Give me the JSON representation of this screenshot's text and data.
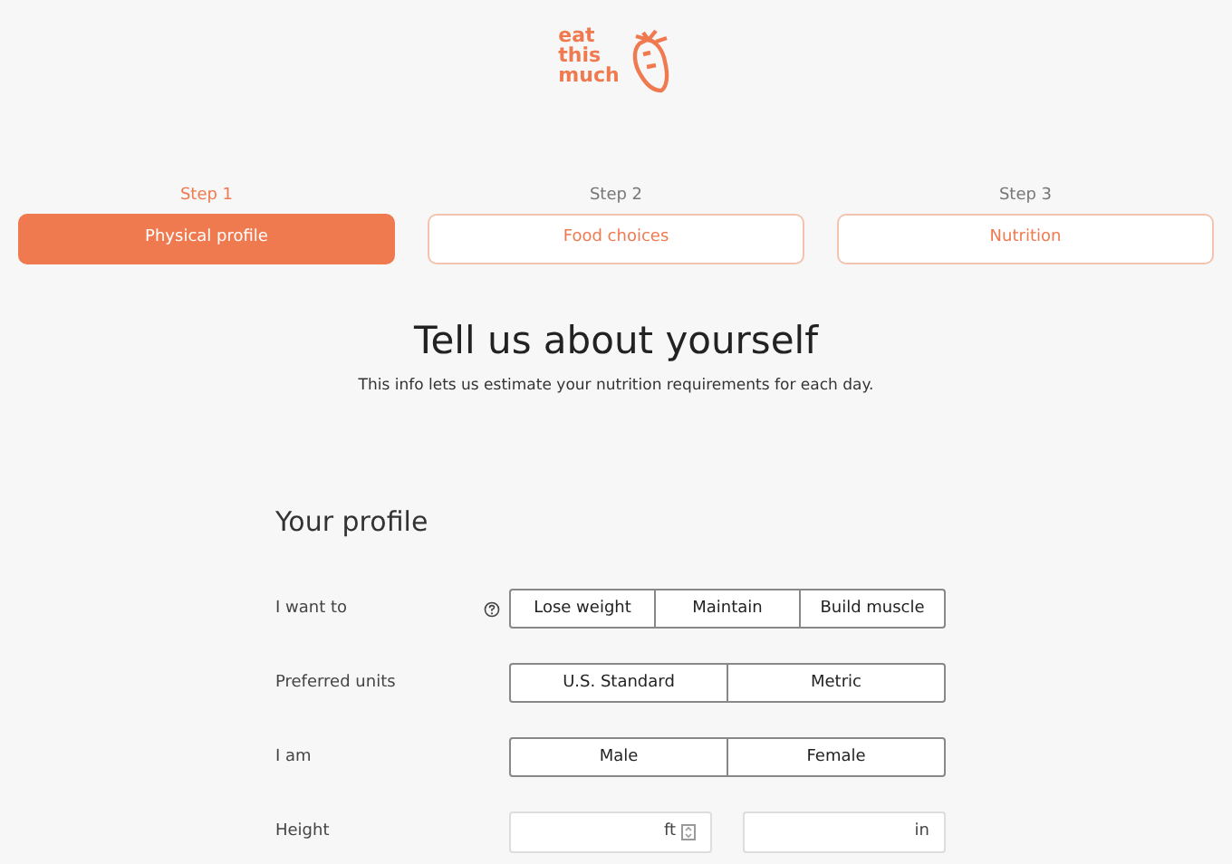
{
  "logo": {
    "lines": [
      "eat",
      "this",
      "much"
    ]
  },
  "steps": [
    {
      "step": "Step 1",
      "label": "Physical profile",
      "selected": true
    },
    {
      "step": "Step 2",
      "label": "Food choices",
      "selected": false
    },
    {
      "step": "Step 3",
      "label": "Nutrition",
      "selected": false
    }
  ],
  "heading": "Tell us about yourself",
  "subheading": "This info lets us estimate your nutrition requirements for each day.",
  "section_title": "Your profile",
  "rows": [
    {
      "kind": "toggle",
      "label": "I want to",
      "help": true,
      "options": [
        {
          "label": "Lose weight",
          "selected": false
        },
        {
          "label": "Maintain",
          "selected": false
        },
        {
          "label": "Build muscle",
          "selected": false
        }
      ]
    },
    {
      "kind": "toggle",
      "label": "Preferred units",
      "help": false,
      "options": [
        {
          "label": "U.S. Standard",
          "selected": false
        },
        {
          "label": "Metric",
          "selected": false
        }
      ]
    },
    {
      "kind": "toggle",
      "label": "I am",
      "help": false,
      "options": [
        {
          "label": "Male",
          "selected": false
        },
        {
          "label": "Female",
          "selected": false
        }
      ]
    },
    {
      "kind": "inputs",
      "label": "Height",
      "help": false,
      "fields": [
        {
          "unit": "ft",
          "spinner": true
        },
        {
          "unit": "in",
          "spinner": false
        }
      ]
    }
  ]
}
